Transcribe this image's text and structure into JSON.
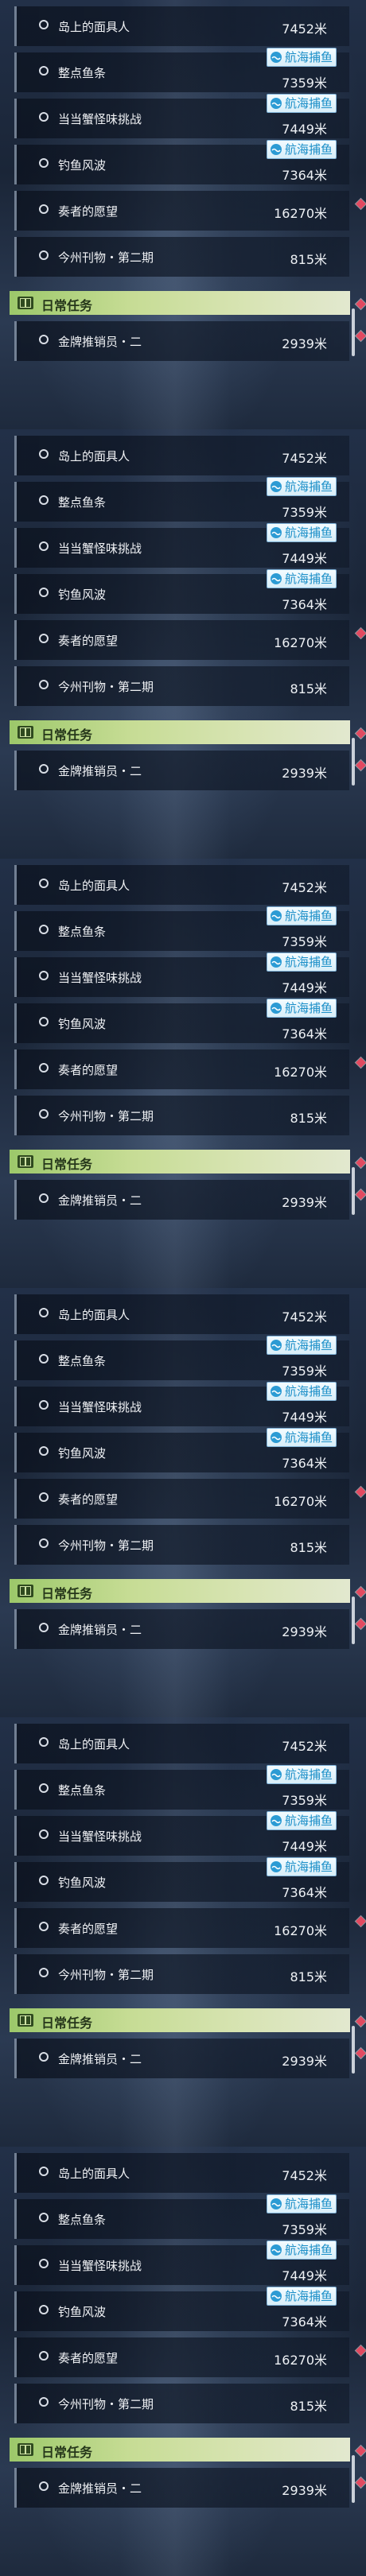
{
  "section_title": "日常任务",
  "tag_label": "航海捕鱼",
  "distance_unit": "米",
  "panels": [
    {
      "quests": [
        {
          "name": "岛上的面具人",
          "distance": "7452米"
        },
        {
          "name": "整点鱼条",
          "distance": "7359米"
        },
        {
          "name": "当当蟹怪味挑战",
          "distance": "7449米"
        },
        {
          "name": "钓鱼风波",
          "distance": "7364米"
        },
        {
          "name": "奏者的愿望",
          "distance": "16270米"
        },
        {
          "name": "今州刊物・第二期",
          "distance": "815米"
        }
      ],
      "daily": [
        {
          "name": "金牌推销员・二",
          "distance": "2939米"
        }
      ]
    },
    {
      "quests": [
        {
          "name": "岛上的面具人",
          "distance": "7452米"
        },
        {
          "name": "整点鱼条",
          "distance": "7359米"
        },
        {
          "name": "当当蟹怪味挑战",
          "distance": "7449米"
        },
        {
          "name": "钓鱼风波",
          "distance": "7364米"
        },
        {
          "name": "奏者的愿望",
          "distance": "16270米"
        },
        {
          "name": "今州刊物・第二期",
          "distance": "815米"
        }
      ],
      "daily": [
        {
          "name": "金牌推销员・二",
          "distance": "2939米"
        }
      ]
    },
    {
      "quests": [
        {
          "name": "岛上的面具人",
          "distance": "7452米"
        },
        {
          "name": "整点鱼条",
          "distance": "7359米"
        },
        {
          "name": "当当蟹怪味挑战",
          "distance": "7449米"
        },
        {
          "name": "钓鱼风波",
          "distance": "7364米"
        },
        {
          "name": "奏者的愿望",
          "distance": "16270米"
        },
        {
          "name": "今州刊物・第二期",
          "distance": "815米"
        }
      ],
      "daily": [
        {
          "name": "金牌推销员・二",
          "distance": "2939米"
        }
      ]
    },
    {
      "quests": [
        {
          "name": "岛上的面具人",
          "distance": "7452米"
        },
        {
          "name": "整点鱼条",
          "distance": "7359米"
        },
        {
          "name": "当当蟹怪味挑战",
          "distance": "7449米"
        },
        {
          "name": "钓鱼风波",
          "distance": "7364米"
        },
        {
          "name": "奏者的愿望",
          "distance": "16270米"
        },
        {
          "name": "今州刊物・第二期",
          "distance": "815米"
        }
      ],
      "daily": [
        {
          "name": "金牌推销员・二",
          "distance": "2939米"
        }
      ]
    },
    {
      "quests": [
        {
          "name": "岛上的面具人",
          "distance": "7452米"
        },
        {
          "name": "整点鱼条",
          "distance": "7359米"
        },
        {
          "name": "当当蟹怪味挑战",
          "distance": "7449米"
        },
        {
          "name": "钓鱼风波",
          "distance": "7364米"
        },
        {
          "name": "奏者的愿望",
          "distance": "16270米"
        },
        {
          "name": "今州刊物・第二期",
          "distance": "815米"
        }
      ],
      "daily": [
        {
          "name": "金牌推销员・二",
          "distance": "2939米"
        }
      ]
    },
    {
      "quests": [
        {
          "name": "岛上的面具人",
          "distance": "7452米"
        },
        {
          "name": "整点鱼条",
          "distance": "7359米"
        },
        {
          "name": "当当蟹怪味挑战",
          "distance": "7449米"
        },
        {
          "name": "钓鱼风波",
          "distance": "7364米"
        },
        {
          "name": "奏者的愿望",
          "distance": "16270米"
        },
        {
          "name": "今州刊物・第二期",
          "distance": "815米"
        }
      ],
      "daily": [
        {
          "name": "金牌推销员・二",
          "distance": "2939米"
        }
      ]
    }
  ],
  "colors": {
    "section_green": "#9cc86a",
    "tag_blue": "#1c8fc8",
    "marker_red": "#e24a61"
  },
  "icons": {
    "quest_status": "circle-outline-icon",
    "section": "book-icon",
    "tag": "wave-icon",
    "tracked": "diamond-marker-icon"
  }
}
